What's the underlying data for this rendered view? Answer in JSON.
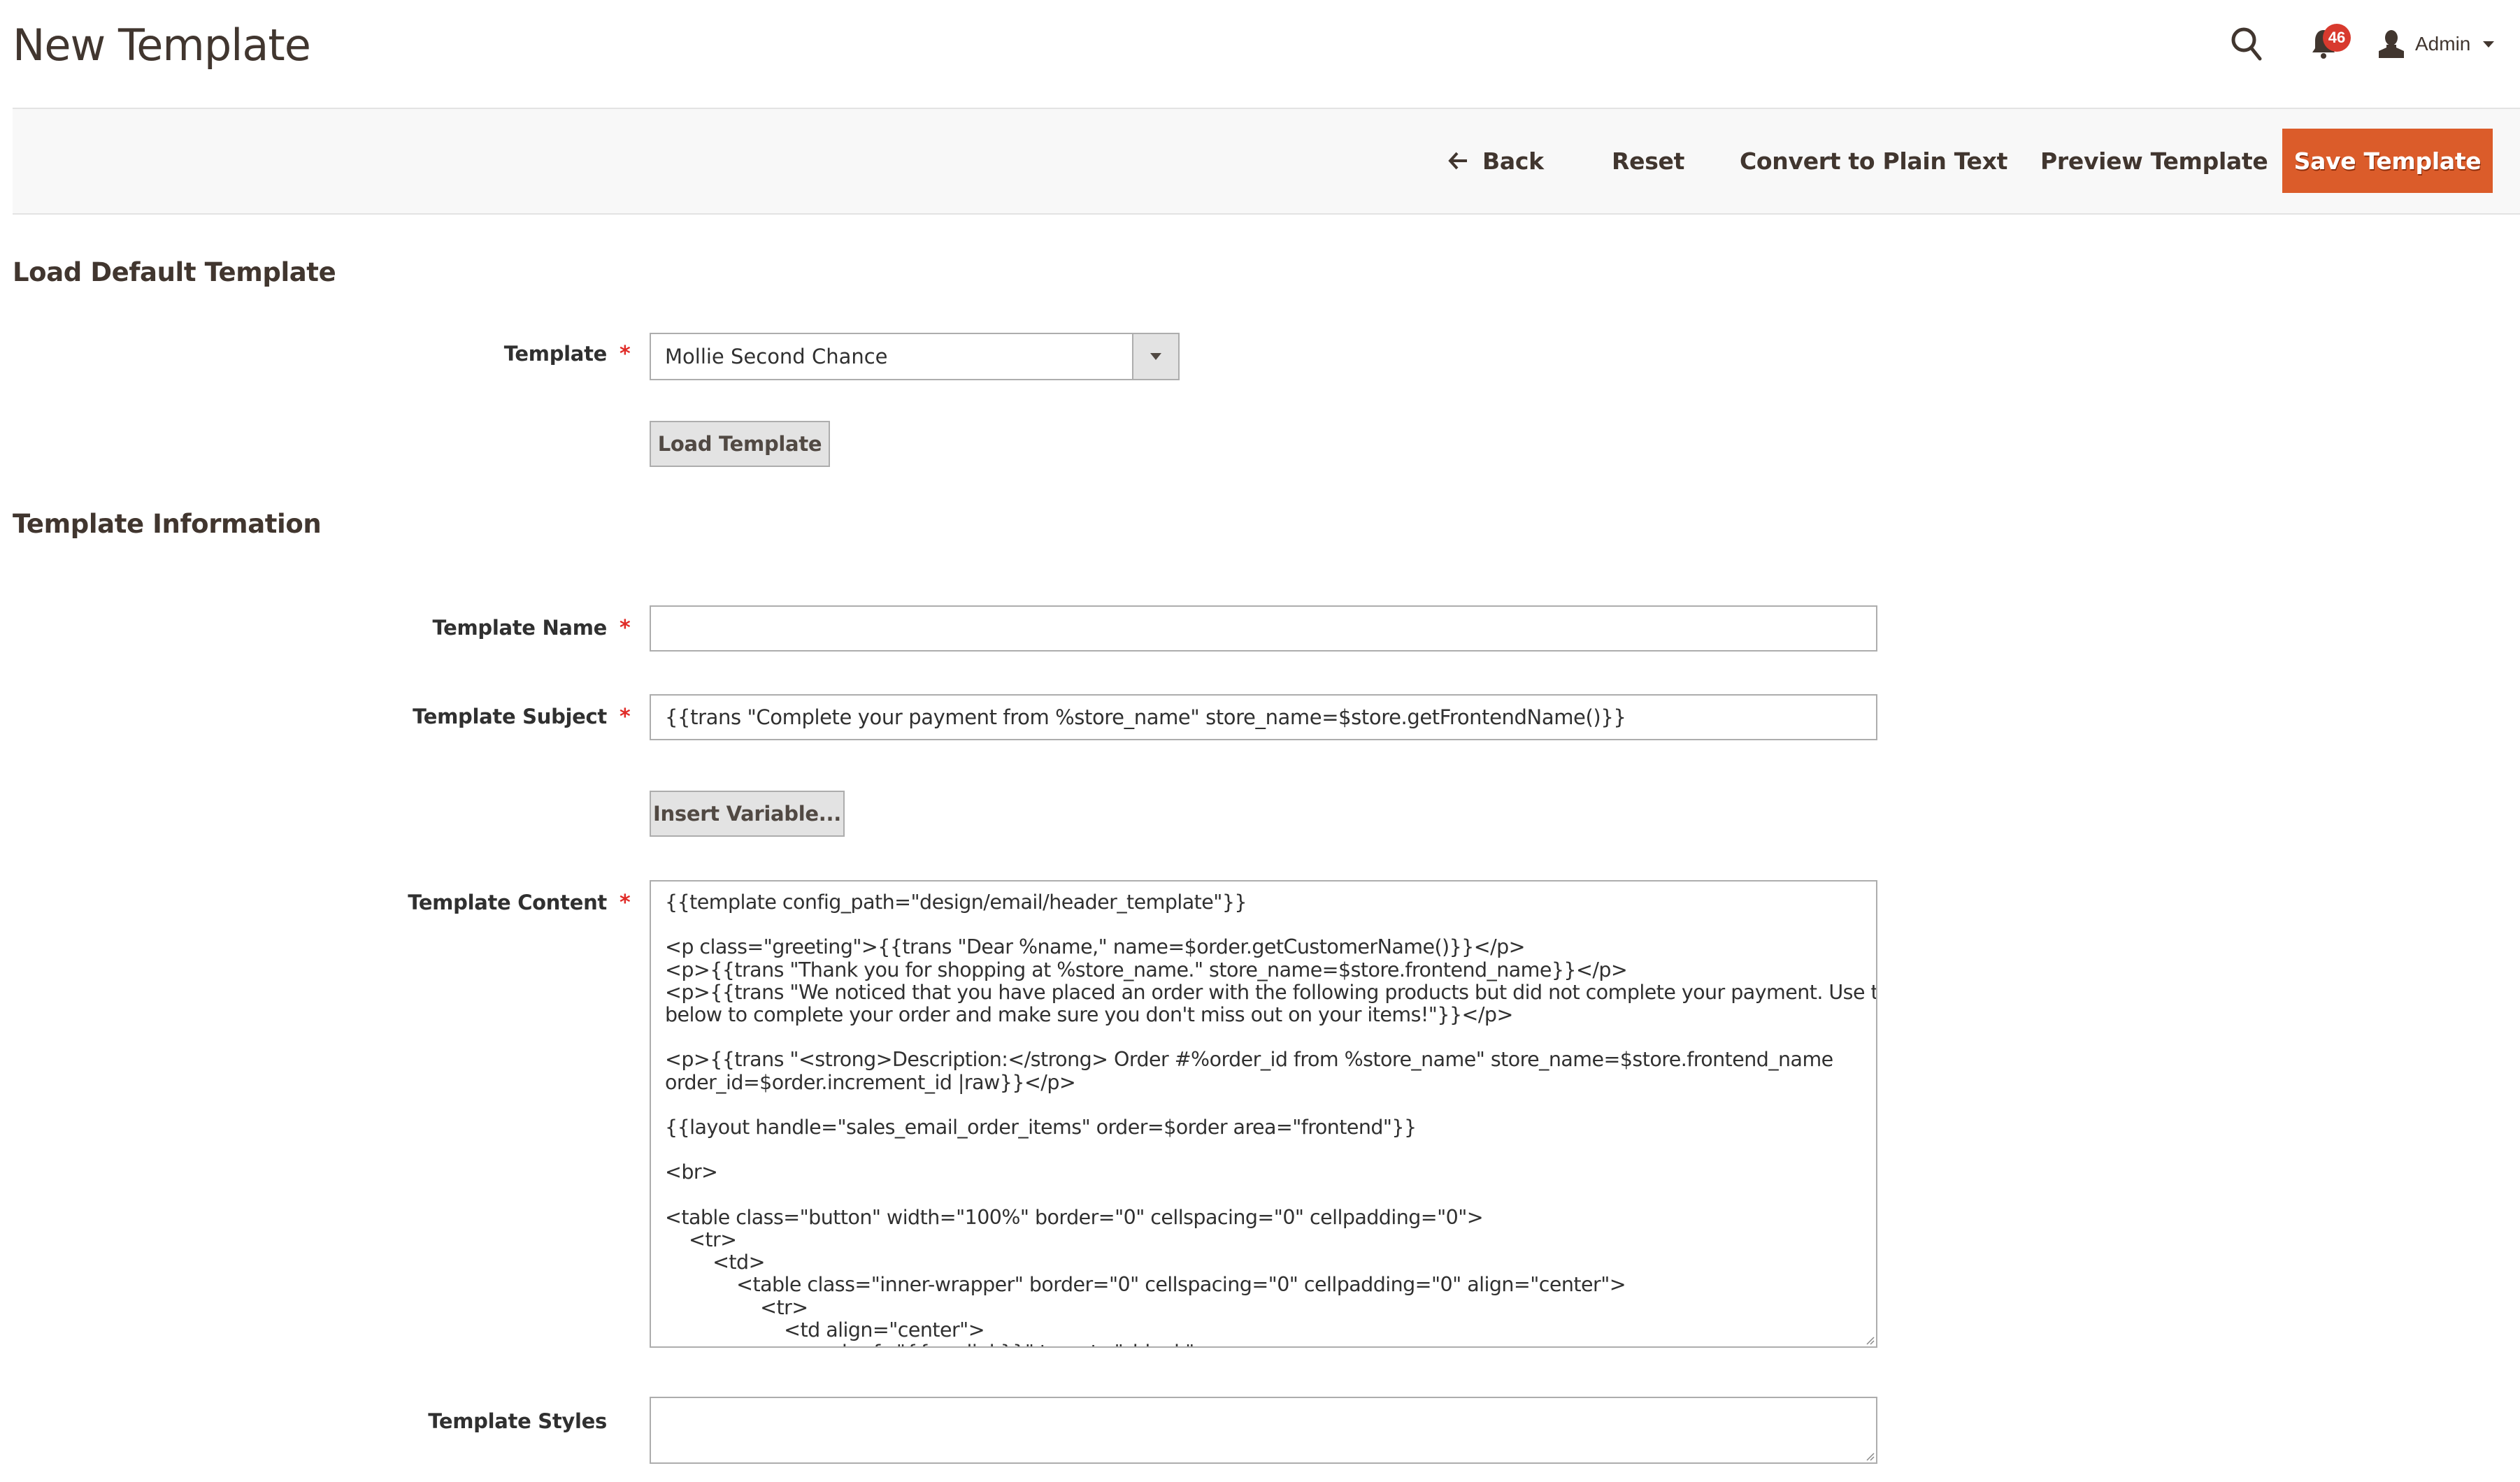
{
  "header": {
    "page_title": "New Template",
    "notifications_count": "46",
    "user_label": "Admin",
    "icons": {
      "search": "search-icon",
      "notifications": "bell-icon",
      "user": "user-icon",
      "user_menu": "caret-down-icon"
    }
  },
  "actions": {
    "back_label": "Back",
    "reset_label": "Reset",
    "convert_label": "Convert to Plain Text",
    "preview_label": "Preview Template",
    "save_label": "Save Template",
    "save_color": "#db5c2a"
  },
  "load_default": {
    "title": "Load Default Template",
    "template_label": "Template",
    "template_selected": "Mollie Second Chance",
    "load_button": "Load Template"
  },
  "template_info": {
    "title": "Template Information",
    "name_label": "Template Name",
    "name_value": "",
    "subject_label": "Template Subject",
    "subject_value": "{{trans \"Complete your payment from %store_name\" store_name=$store.getFrontendName()}}",
    "insert_variable_button": "Insert Variable...",
    "content_label": "Template Content",
    "content_value": "{{template config_path=\"design/email/header_template\"}}\n\n<p class=\"greeting\">{{trans \"Dear %name,\" name=$order.getCustomerName()}}</p>\n<p>{{trans \"Thank you for shopping at %store_name.\" store_name=$store.frontend_name}}</p>\n<p>{{trans \"We noticed that you have placed an order with the following products but did not complete your payment. Use the link\nbelow to complete your order and make sure you don't miss out on your items!\"}}</p>\n\n<p>{{trans \"<strong>Description:</strong> Order #%order_id from %store_name\" store_name=$store.frontend_name\norder_id=$order.increment_id |raw}}</p>\n\n{{layout handle=\"sales_email_order_items\" order=$order area=\"frontend\"}}\n\n<br>\n\n<table class=\"button\" width=\"100%\" border=\"0\" cellspacing=\"0\" cellpadding=\"0\">\n    <tr>\n        <td>\n            <table class=\"inner-wrapper\" border=\"0\" cellspacing=\"0\" cellpadding=\"0\" align=\"center\">\n                <tr>\n                    <td align=\"center\">\n                        <a href=\"{{var link}}\" target=\"_blank\">",
    "styles_label": "Template Styles",
    "styles_value": ""
  },
  "required_marker": "*"
}
